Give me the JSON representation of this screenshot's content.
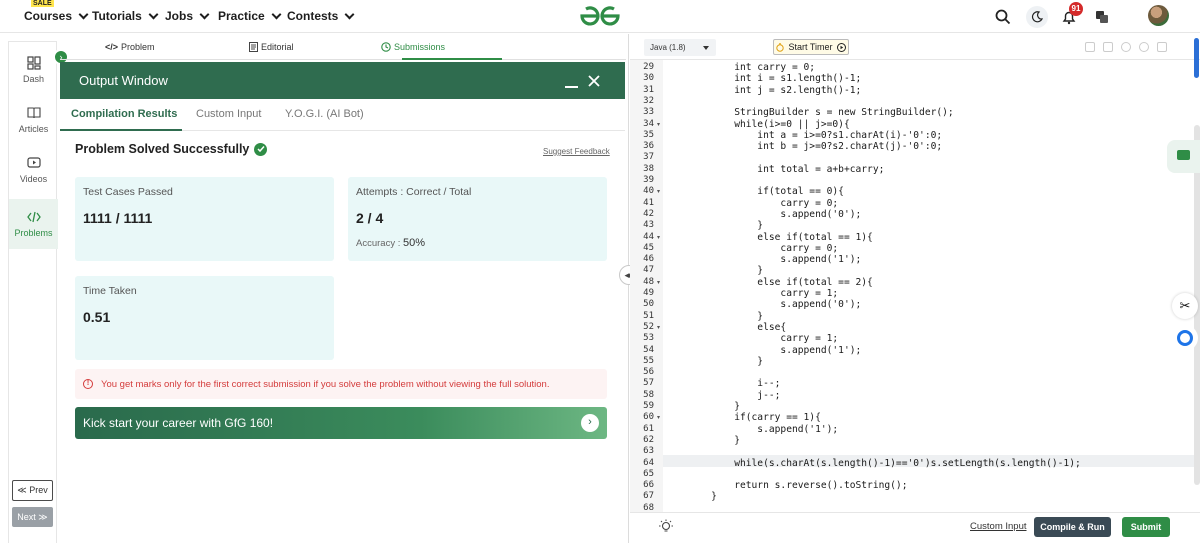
{
  "topnav": {
    "sale_badge": "SALE",
    "items": [
      "Courses",
      "Tutorials",
      "Jobs",
      "Practice",
      "Contests"
    ],
    "notification_count": "91"
  },
  "rail": {
    "items": [
      "Dash",
      "Articles",
      "Videos",
      "Problems"
    ],
    "prev": "≪ Prev",
    "next": "Next ≫"
  },
  "problem_tabs": [
    "Problem",
    "Editorial",
    "Submissions"
  ],
  "output_window": {
    "title": "Output Window",
    "tabs": [
      "Compilation Results",
      "Custom Input",
      "Y.O.G.I. (AI Bot)"
    ],
    "status": "Problem Solved Successfully",
    "suggest_feedback": "Suggest Feedback",
    "cards": {
      "test_cases_label": "Test Cases Passed",
      "test_cases_value": "1111 / 1111",
      "attempts_label": "Attempts : Correct / Total",
      "attempts_value": "2 / 4",
      "accuracy_label": "Accuracy :",
      "accuracy_value": "50%",
      "time_label": "Time Taken",
      "time_value": "0.51"
    },
    "warning": "You get marks only for the first correct submission if you solve the problem without viewing the full solution.",
    "promo": "Kick start your career with GfG 160!"
  },
  "editor": {
    "language": "Java (1.8)",
    "timer_label": "Start Timer",
    "lines": [
      {
        "n": "29",
        "t": "        int carry = 0;"
      },
      {
        "n": "30",
        "t": "        int i = s1.length()-1;"
      },
      {
        "n": "31",
        "t": "        int j = s2.length()-1;"
      },
      {
        "n": "32",
        "t": ""
      },
      {
        "n": "33",
        "t": "        StringBuilder s = new StringBuilder();"
      },
      {
        "n": "34",
        "t": "        while(i>=0 || j>=0){",
        "fold": true
      },
      {
        "n": "35",
        "t": "            int a = i>=0?s1.charAt(i)-'0':0;"
      },
      {
        "n": "36",
        "t": "            int b = j>=0?s2.charAt(j)-'0':0;"
      },
      {
        "n": "37",
        "t": ""
      },
      {
        "n": "38",
        "t": "            int total = a+b+carry;"
      },
      {
        "n": "39",
        "t": ""
      },
      {
        "n": "40",
        "t": "            if(total == 0){",
        "fold": true
      },
      {
        "n": "41",
        "t": "                carry = 0;"
      },
      {
        "n": "42",
        "t": "                s.append('0');"
      },
      {
        "n": "43",
        "t": "            }"
      },
      {
        "n": "44",
        "t": "            else if(total == 1){",
        "fold": true
      },
      {
        "n": "45",
        "t": "                carry = 0;"
      },
      {
        "n": "46",
        "t": "                s.append('1');"
      },
      {
        "n": "47",
        "t": "            }"
      },
      {
        "n": "48",
        "t": "            else if(total == 2){",
        "fold": true
      },
      {
        "n": "49",
        "t": "                carry = 1;"
      },
      {
        "n": "50",
        "t": "                s.append('0');"
      },
      {
        "n": "51",
        "t": "            }"
      },
      {
        "n": "52",
        "t": "            else{",
        "fold": true
      },
      {
        "n": "53",
        "t": "                carry = 1;"
      },
      {
        "n": "54",
        "t": "                s.append('1');"
      },
      {
        "n": "55",
        "t": "            }"
      },
      {
        "n": "56",
        "t": ""
      },
      {
        "n": "57",
        "t": "            i--;"
      },
      {
        "n": "58",
        "t": "            j--;"
      },
      {
        "n": "59",
        "t": "        }"
      },
      {
        "n": "60",
        "t": "        if(carry == 1){",
        "fold": true
      },
      {
        "n": "61",
        "t": "            s.append('1');"
      },
      {
        "n": "62",
        "t": "        }"
      },
      {
        "n": "63",
        "t": ""
      },
      {
        "n": "64",
        "t": "        while(s.charAt(s.length()-1)=='0')s.setLength(s.length()-1);"
      },
      {
        "n": "65",
        "t": ""
      },
      {
        "n": "66",
        "t": "        return s.reverse().toString();"
      },
      {
        "n": "67",
        "t": "    }"
      },
      {
        "n": "68",
        "t": ""
      }
    ]
  },
  "bottombar": {
    "custom_input": "Custom Input",
    "compile_run": "Compile & Run",
    "submit": "Submit"
  },
  "colors": {
    "brand_green": "#2f8d46",
    "output_header": "#2f6c4f",
    "card_bg": "#e9f8f8",
    "warning_red": "#d43c3c"
  }
}
